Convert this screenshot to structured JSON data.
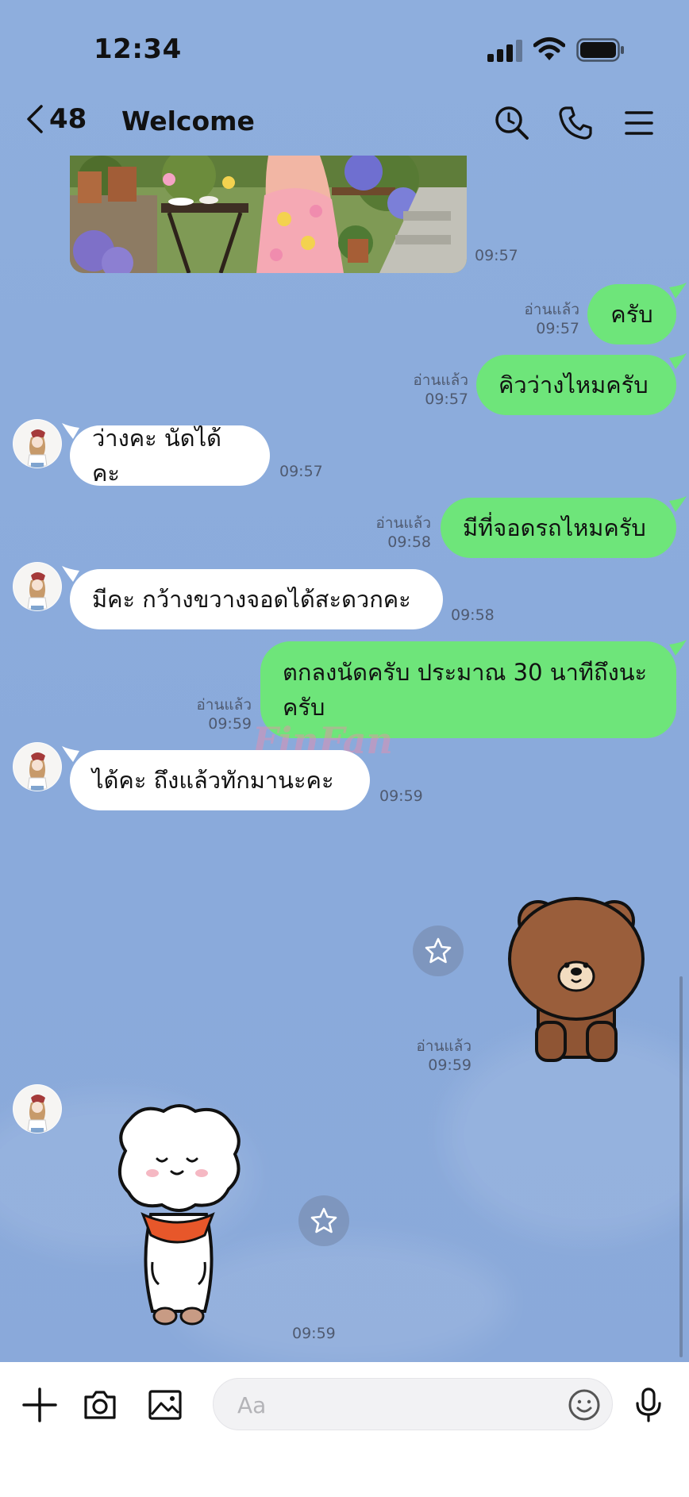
{
  "status": {
    "time": "12:34"
  },
  "header": {
    "back_count": "48",
    "title": "Welcome"
  },
  "messages": [
    {
      "side": "in",
      "kind": "photo",
      "time": "09:57"
    },
    {
      "side": "out",
      "text": "ครับ",
      "read": "อ่านแล้ว",
      "time": "09:57"
    },
    {
      "side": "out",
      "text": "คิวว่างไหมครับ",
      "read": "อ่านแล้ว",
      "time": "09:57"
    },
    {
      "side": "in",
      "text": "ว่างคะ นัดได้คะ",
      "time": "09:57"
    },
    {
      "side": "out",
      "text": "มีที่จอดรถไหมครับ",
      "read": "อ่านแล้ว",
      "time": "09:58"
    },
    {
      "side": "in",
      "text": "มีคะ กว้างขวางจอดได้สะดวกคะ",
      "time": "09:58"
    },
    {
      "side": "out",
      "text_line1": "ตกลงนัดครับ ประมาณ 30 นาทีถึงนะ",
      "text_line2": "ครับ",
      "read": "อ่านแล้ว",
      "time": "09:59"
    },
    {
      "side": "in",
      "text": "ได้คะ  ถึงแล้วทักมานะคะ",
      "time": "09:59"
    },
    {
      "side": "out",
      "kind": "sticker",
      "sticker": "brown-bear-sticker",
      "read": "อ่านแล้ว",
      "time": "09:59"
    },
    {
      "side": "in",
      "kind": "sticker",
      "sticker": "white-sheep-sticker",
      "time": "09:59"
    }
  ],
  "watermark": "FinFan",
  "composer": {
    "placeholder": "Aa"
  },
  "icons": [
    "back-icon",
    "search-icon",
    "phone-icon",
    "menu-icon",
    "plus-icon",
    "camera-icon",
    "image-icon",
    "emoji-icon",
    "microphone-icon",
    "star-icon"
  ],
  "colors": {
    "background": "#8eaedd",
    "outgoing_bubble": "#6ee57a",
    "incoming_bubble": "#ffffff"
  }
}
